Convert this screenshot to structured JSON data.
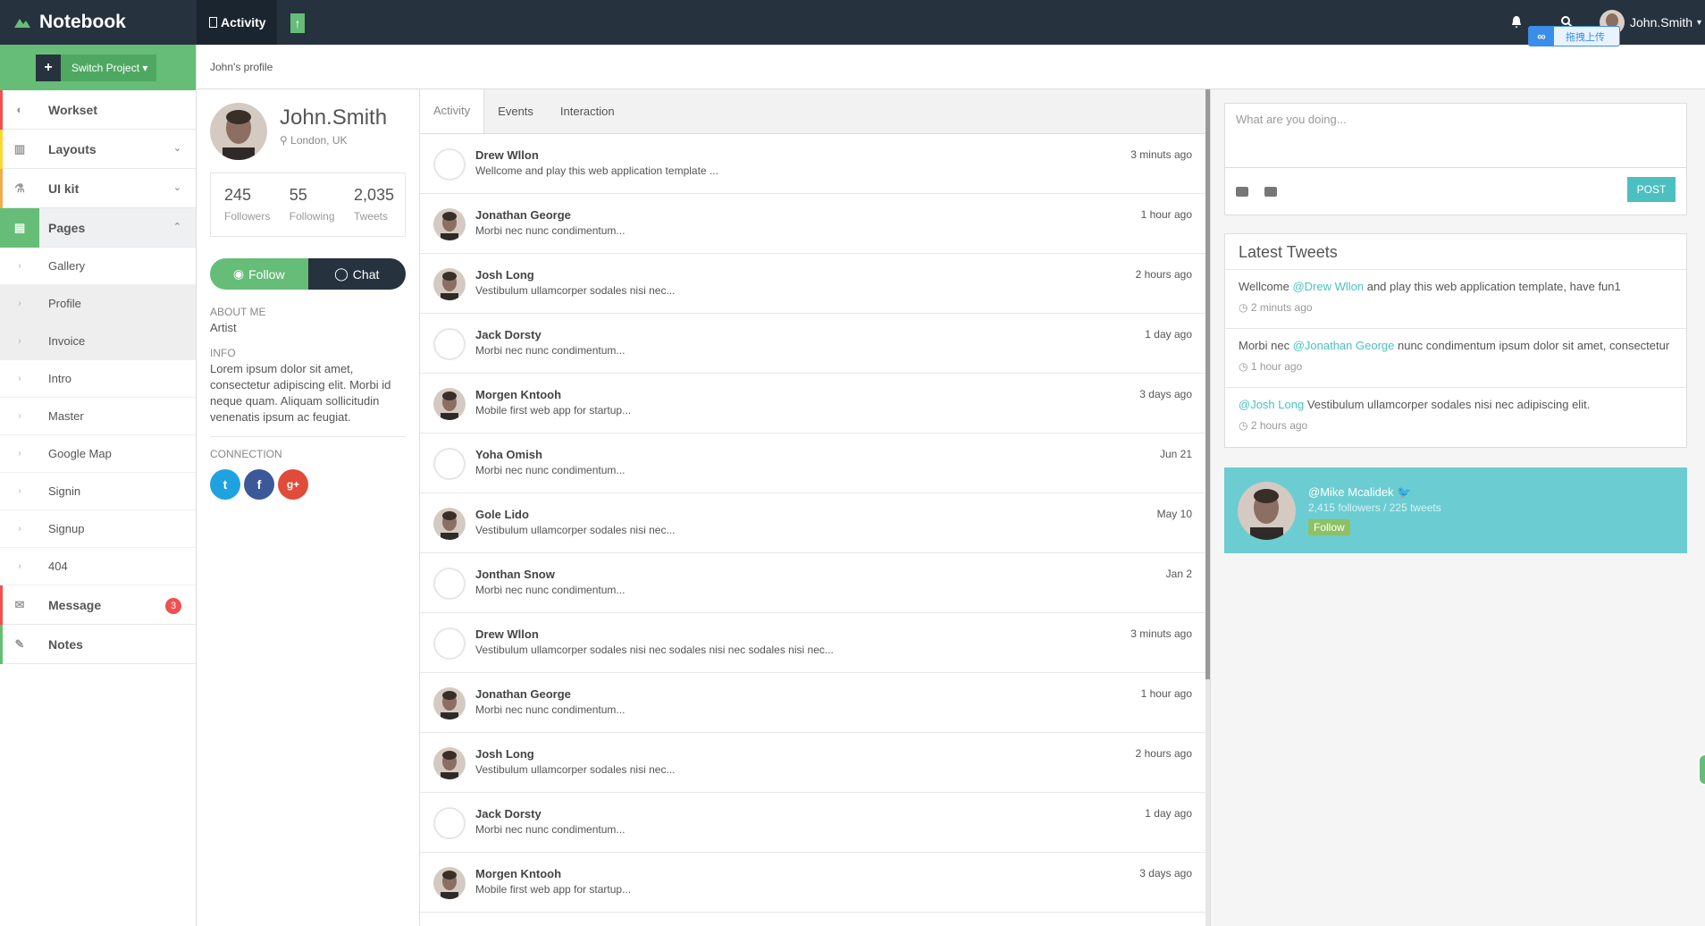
{
  "app": {
    "brand": "Notebook",
    "top_tab": "Activity",
    "user_name": "John.Smith",
    "baidu_label": "拖拽上传"
  },
  "sidebar": {
    "switch_label": "Switch Project",
    "items": [
      {
        "label": "Workset",
        "color": "#f05050"
      },
      {
        "label": "Layouts",
        "color": "#fad733"
      },
      {
        "label": "UI kit",
        "color": "#f0ad4e"
      },
      {
        "label": "Pages",
        "color": "#65bd77"
      }
    ],
    "sub_items": [
      "Gallery",
      "Profile",
      "Invoice",
      "Intro",
      "Master",
      "Google Map",
      "Signin",
      "Signup",
      "404"
    ],
    "message": {
      "label": "Message",
      "badge": "3"
    },
    "notes": {
      "label": "Notes"
    }
  },
  "breadcrumb": "John's profile",
  "profile": {
    "name": "John.Smith",
    "location": "London, UK",
    "stats": [
      {
        "value": "245",
        "label": "Followers"
      },
      {
        "value": "55",
        "label": "Following"
      },
      {
        "value": "2,035",
        "label": "Tweets"
      }
    ],
    "follow_label": "Follow",
    "chat_label": "Chat",
    "about_label": "ABOUT ME",
    "about_value": "Artist",
    "info_label": "INFO",
    "info_value": "Lorem ipsum dolor sit amet, consectetur adipiscing elit. Morbi id neque quam. Aliquam sollicitudin venenatis ipsum ac feugiat.",
    "connection_label": "CONNECTION"
  },
  "tabs": [
    "Activity",
    "Events",
    "Interaction"
  ],
  "feed": [
    {
      "name": "Drew Wllon",
      "text": "Wellcome and play this web application template ...",
      "time": "3 minuts ago",
      "avatar": "empty"
    },
    {
      "name": "Jonathan George",
      "text": "Morbi nec nunc condimentum...",
      "time": "1 hour ago",
      "avatar": "photo"
    },
    {
      "name": "Josh Long",
      "text": "Vestibulum ullamcorper sodales nisi nec...",
      "time": "2 hours ago",
      "avatar": "photo"
    },
    {
      "name": "Jack Dorsty",
      "text": "Morbi nec nunc condimentum...",
      "time": "1 day ago",
      "avatar": "empty"
    },
    {
      "name": "Morgen Kntooh",
      "text": "Mobile first web app for startup...",
      "time": "3 days ago",
      "avatar": "photo"
    },
    {
      "name": "Yoha Omish",
      "text": "Morbi nec nunc condimentum...",
      "time": "Jun 21",
      "avatar": "empty"
    },
    {
      "name": "Gole Lido",
      "text": "Vestibulum ullamcorper sodales nisi nec...",
      "time": "May 10",
      "avatar": "photo"
    },
    {
      "name": "Jonthan Snow",
      "text": "Morbi nec nunc condimentum...",
      "time": "Jan 2",
      "avatar": "empty"
    },
    {
      "name": "Drew Wllon",
      "text": "Vestibulum ullamcorper sodales nisi nec sodales nisi nec sodales nisi nec...",
      "time": "3 minuts ago",
      "avatar": "empty"
    },
    {
      "name": "Jonathan George",
      "text": "Morbi nec nunc condimentum...",
      "time": "1 hour ago",
      "avatar": "photo"
    },
    {
      "name": "Josh Long",
      "text": "Vestibulum ullamcorper sodales nisi nec...",
      "time": "2 hours ago",
      "avatar": "photo"
    },
    {
      "name": "Jack Dorsty",
      "text": "Morbi nec nunc condimentum...",
      "time": "1 day ago",
      "avatar": "empty"
    },
    {
      "name": "Morgen Kntooh",
      "text": "Mobile first web app for startup...",
      "time": "3 days ago",
      "avatar": "photo"
    }
  ],
  "post": {
    "placeholder": "What are you doing...",
    "button": "POST"
  },
  "tweets": {
    "title": "Latest Tweets",
    "items": [
      {
        "before": "Wellcome ",
        "mention": "@Drew Wllon",
        "after": " and play this web application template, have fun1",
        "time": "2 minuts ago"
      },
      {
        "before": "Morbi nec ",
        "mention": "@Jonathan George",
        "after": " nunc condimentum ipsum dolor sit amet, consectetur",
        "time": "1 hour ago"
      },
      {
        "before": "",
        "mention": "@Josh Long",
        "after": " Vestibulum ullamcorper sodales nisi nec adipiscing elit.",
        "time": "2 hours ago"
      }
    ]
  },
  "card": {
    "handle": "@Mike Mcalidek",
    "sub": "2,415 followers / 225 tweets",
    "follow": "Follow"
  }
}
